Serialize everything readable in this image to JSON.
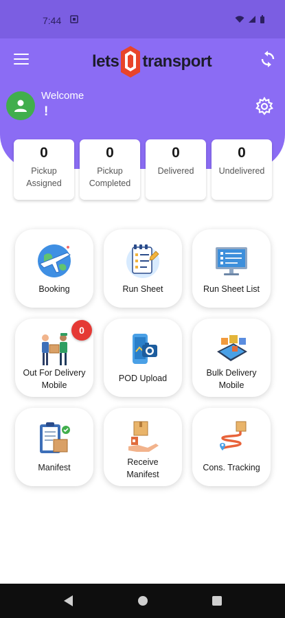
{
  "status_bar": {
    "time": "7:44"
  },
  "header": {
    "logo_left": "lets",
    "logo_right": "transport",
    "welcome": "Welcome",
    "user_name": "!",
    "color": "#8b6cf4"
  },
  "stats": [
    {
      "value": "0",
      "label_line1": "Pickup",
      "label_line2": "Assigned"
    },
    {
      "value": "0",
      "label_line1": "Pickup",
      "label_line2": "Completed"
    },
    {
      "value": "0",
      "label_line1": "Delivered",
      "label_line2": ""
    },
    {
      "value": "0",
      "label_line1": "Undelivered",
      "label_line2": ""
    }
  ],
  "tiles": [
    {
      "line1": "Booking",
      "line2": "",
      "icon": "globe-plane-icon"
    },
    {
      "line1": "Run Sheet",
      "line2": "",
      "icon": "notepad-pencil-icon"
    },
    {
      "line1": "Run Sheet List",
      "line2": "",
      "icon": "monitor-checklist-icon"
    },
    {
      "line1": "Out For Delivery",
      "line2": "Mobile",
      "icon": "delivery-men-icon"
    },
    {
      "line1": "POD Upload",
      "line2": "",
      "icon": "phone-camera-icon"
    },
    {
      "line1": "Bulk Delivery",
      "line2": "Mobile",
      "icon": "tablet-boxes-icon"
    },
    {
      "line1": "Manifest",
      "line2": "",
      "icon": "clipboard-box-icon"
    },
    {
      "line1": "Receive",
      "line2": "Manifest",
      "icon": "hand-box-icon"
    },
    {
      "line1": "Cons. Tracking",
      "line2": "",
      "icon": "route-pin-icon"
    }
  ],
  "badge": {
    "count": "0",
    "color": "#e53935"
  }
}
